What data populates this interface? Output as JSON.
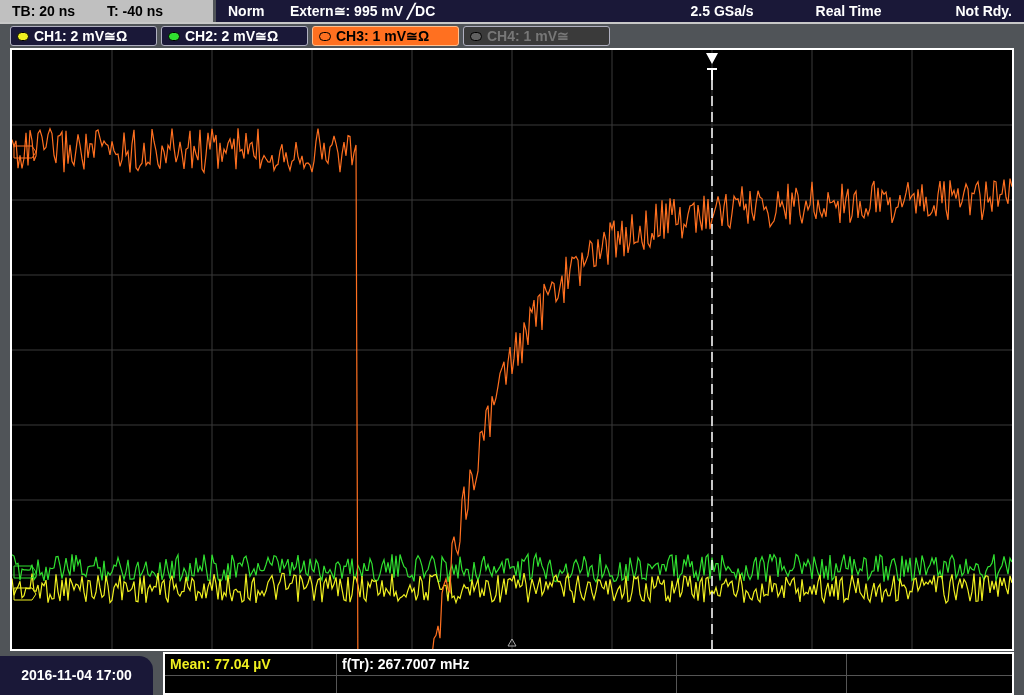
{
  "status_bar": {
    "timebase": "TB: 20 ns",
    "trigger_time": "T: -40 ns",
    "mode": "Norm",
    "trigger": "Extern≅: 995 mV ╱DC",
    "sample_rate": "2.5 GSa/s",
    "acquisition": "Real Time",
    "state": "Not Rdy."
  },
  "channels": [
    {
      "label": "CH1: 2 mV≅Ω",
      "color": "#f0f020",
      "selected": false,
      "enabled": true
    },
    {
      "label": "CH2: 2 mV≅Ω",
      "color": "#30e030",
      "selected": false,
      "enabled": true
    },
    {
      "label": "CH3: 1 mV≅Ω",
      "color": "#ff7020",
      "selected": true,
      "enabled": true
    },
    {
      "label": "CH4: 1 mV≅",
      "color": "#606060",
      "selected": false,
      "enabled": false
    }
  ],
  "date": "2016-11-04 17:00",
  "measurements": [
    {
      "text": "Mean: 77.04 µV",
      "color": "#f0f020"
    },
    {
      "text": "f(Tr): 267.7007 mHz",
      "color": "#ffffff"
    }
  ]
}
